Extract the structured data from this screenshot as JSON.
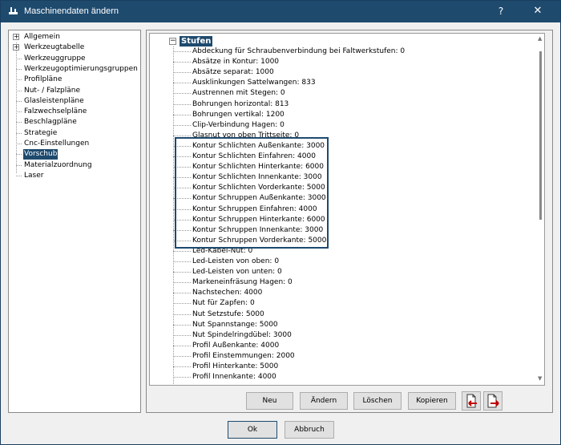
{
  "window": {
    "title": "Maschinendaten ändern",
    "help_label": "?",
    "close_label": "✕",
    "accent_color": "#1e4a6e"
  },
  "left_tree": {
    "items": [
      {
        "label": "Allgemein",
        "expander": "+"
      },
      {
        "label": "Werkzeugtabelle",
        "expander": "+"
      },
      {
        "label": "Werkzeuggruppe"
      },
      {
        "label": "Werkzeugoptimierungsgruppen"
      },
      {
        "label": "Profilpläne"
      },
      {
        "label": "Nut- / Falzpläne"
      },
      {
        "label": "Glasleistenpläne"
      },
      {
        "label": "Falzwechselpläne"
      },
      {
        "label": "Beschlagpläne"
      },
      {
        "label": "Strategie"
      },
      {
        "label": "Cnc-Einstellungen"
      },
      {
        "label": "Vorschub",
        "selected": true
      },
      {
        "label": "Materialzuordnung"
      },
      {
        "label": "Laser"
      }
    ]
  },
  "right_tree": {
    "root_expander": "−",
    "root_label": "Stufen",
    "items": [
      "Abdeckung für Schraubenverbindung bei Faltwerkstufen: 0",
      "Absätze in Kontur: 1000",
      "Absätze separat: 1000",
      "Ausklinkungen Sattelwangen: 833",
      "Austrennen mit Stegen: 0",
      "Bohrungen horizontal: 813",
      "Bohrungen vertikal: 1200",
      "Clip-Verbindung Hagen: 0",
      "Glasnut von oben Trittseite: 0",
      "Kontur Schlichten Außenkante: 3000",
      "Kontur Schlichten Einfahren: 4000",
      "Kontur Schlichten Hinterkante: 6000",
      "Kontur Schlichten Innenkante: 3000",
      "Kontur Schlichten Vorderkante: 5000",
      "Kontur Schruppen Außenkante: 3000",
      "Kontur Schruppen Einfahren: 4000",
      "Kontur Schruppen Hinterkante: 6000",
      "Kontur Schruppen Innenkante: 3000",
      "Kontur Schruppen Vorderkante: 5000",
      "Led-Kabel-Nut: 0",
      "Led-Leisten von oben: 0",
      "Led-Leisten von unten: 0",
      "Markeneinfräsung Hagen: 0",
      "Nachstechen: 4000",
      "Nut für Zapfen: 0",
      "Nut Setzstufe: 5000",
      "Nut Spannstange: 5000",
      "Nut Spindelringdübel: 3000",
      "Profil Außenkante: 4000",
      "Profil Einstemmungen: 2000",
      "Profil Hinterkante: 5000",
      "Profil Innenkante: 4000"
    ]
  },
  "actions": {
    "neu": "Neu",
    "aendern": "Ändern",
    "loeschen": "Löschen",
    "kopieren": "Kopieren",
    "import_icon": "document-import-icon",
    "export_icon": "document-export-icon"
  },
  "footer": {
    "ok": "Ok",
    "abbruch": "Abbruch"
  }
}
